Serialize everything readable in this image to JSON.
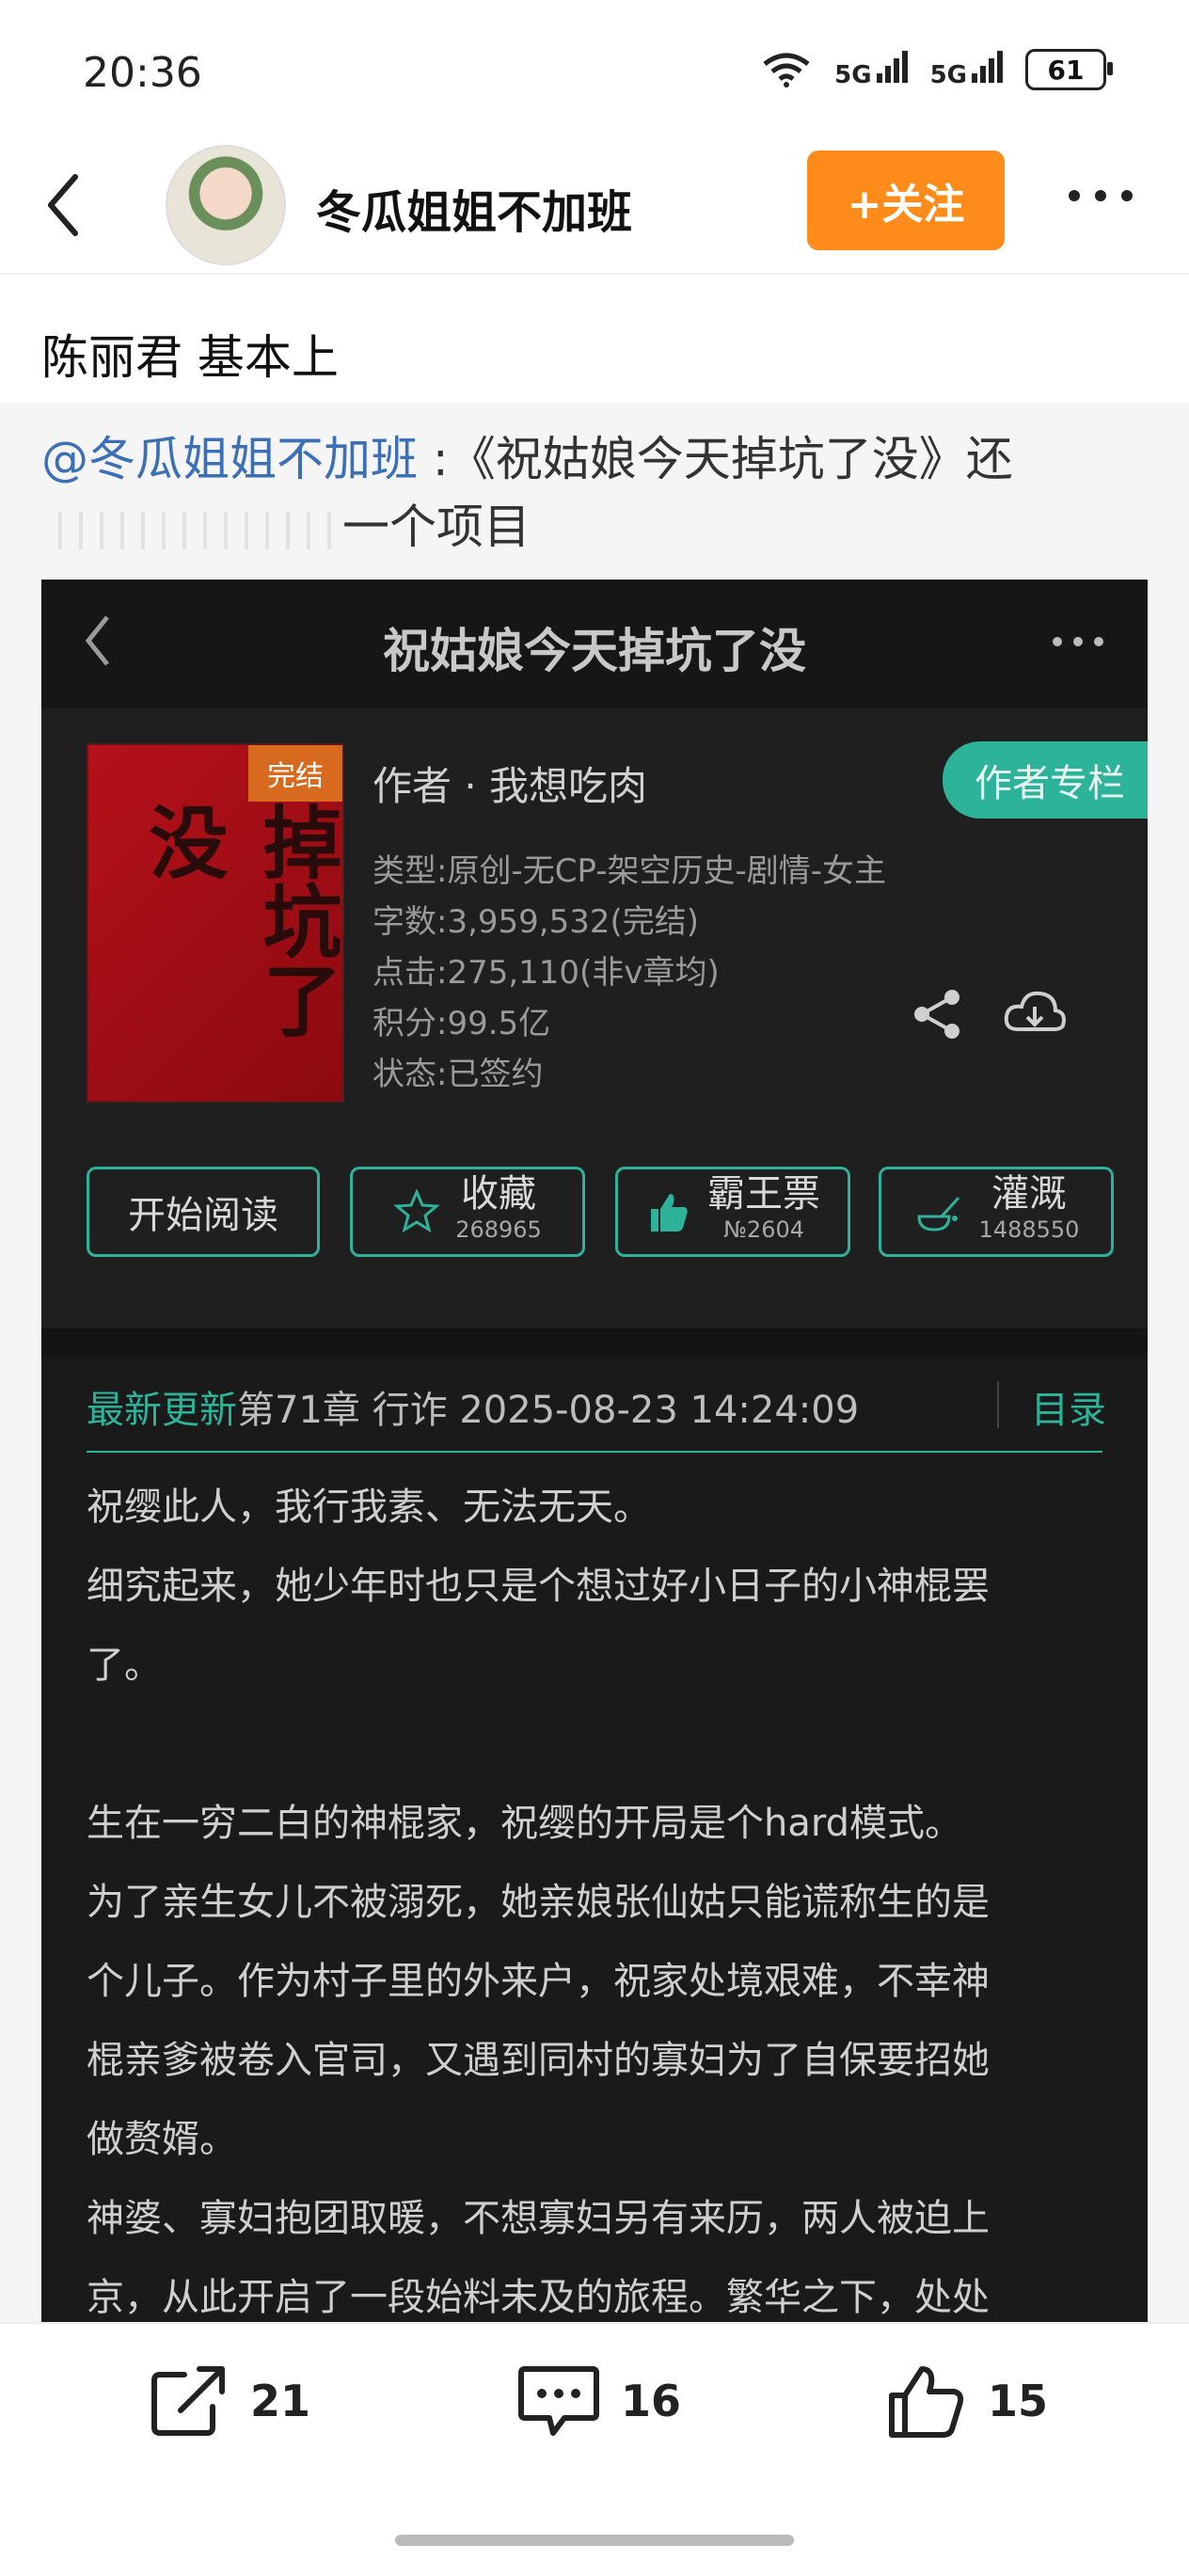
{
  "status_bar": {
    "time": "20:36",
    "network1": "5G",
    "network2": "5G",
    "battery": "61"
  },
  "header": {
    "user_name": "冬瓜姐姐不加班",
    "follow_label": "+关注"
  },
  "post": {
    "text": "陈丽君 基本上"
  },
  "quote": {
    "mention": "@冬瓜姐姐不加班",
    "text_rest": " :《祝姑娘今天掉坑了没》还",
    "text_line2": "一个项目"
  },
  "embed": {
    "title": "祝姑娘今天掉坑了没",
    "cover_text": "掉坑了没",
    "cover_badge": "完结",
    "author": "作者 · 我想吃肉",
    "author_column": "作者专栏",
    "meta": [
      "类型:原创-无CP-架空历史-剧情-女主",
      "字数:3,959,532(完结)",
      "点击:275,110(非v章均)",
      "积分:99.5亿",
      "状态:已签约"
    ],
    "actions": {
      "read": "开始阅读",
      "collect": "收藏",
      "collect_count": "268965",
      "vote": "霸王票",
      "vote_count": "№2604",
      "water": "灌溉",
      "water_count": "1488550"
    },
    "latest_label": "最新更新",
    "latest_text": "第71章 行诈 2025-08-23 14:24:09",
    "toc_label": "目录",
    "paragraphs": [
      "祝缨此人，我行我素、无法无天。",
      "细究起来，她少年时也只是个想过好小日子的小神棍罢",
      "了。",
      "生在一穷二白的神棍家，祝缨的开局是个hard模式。",
      "为了亲生女儿不被溺死，她亲娘张仙姑只能谎称生的是",
      "个儿子。作为村子里的外来户，祝家处境艰难，不幸神",
      "棍亲爹被卷入官司，又遇到同村的寡妇为了自保要招她",
      "做赘婿。",
      "神婆、寡妇抱团取暖，不想寡妇另有来历，两人被迫上",
      "京，从此开启了一段始料未及的旅程。繁华之下，处处"
    ]
  },
  "bottom_bar": {
    "share_count": "21",
    "comment_count": "16",
    "like_count": "15"
  },
  "colors": {
    "accent_orange": "#ff8c1a",
    "teal": "#2db39a",
    "link_blue": "#3b6fb6"
  }
}
